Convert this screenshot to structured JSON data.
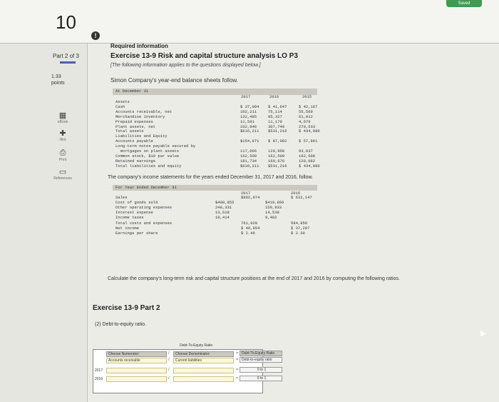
{
  "header": {
    "question_number": "10",
    "save_label": "Saved"
  },
  "sidebar": {
    "part": "Part 2 of 3",
    "points_value": "1.33",
    "points_label": "points",
    "items": [
      {
        "icon": "book-icon",
        "label": "eBook"
      },
      {
        "icon": "hint-icon",
        "label": "Hint"
      },
      {
        "icon": "print-icon",
        "label": "Print"
      },
      {
        "icon": "references-icon",
        "label": "References"
      }
    ]
  },
  "main": {
    "required": "Required information",
    "exercise_title": "Exercise 13-9 Risk and capital structure analysis LO P3",
    "note": "[The following information applies to the questions displayed below.]",
    "intro": "Simon Company's year-end balance sheets follow.",
    "balance_sheet": {
      "header": "At December 31",
      "years": [
        "2017",
        "2016",
        "2015"
      ],
      "rows": [
        {
          "label": "Assets",
          "vals": [
            "",
            "",
            ""
          ]
        },
        {
          "label": "Cash",
          "vals": [
            "$ 37,004",
            "$ 41,647",
            "$ 42,187"
          ]
        },
        {
          "label": "Accounts receivable, net",
          "vals": [
            "102,211",
            "75,114",
            "55,569"
          ]
        },
        {
          "label": "Merchandise inventory",
          "vals": [
            "132,485",
            "95,327",
            "61,012"
          ]
        },
        {
          "label": "Prepaid expenses",
          "vals": [
            "11,591",
            "11,179",
            "4,679"
          ]
        },
        {
          "label": "Plant assets, net",
          "vals": [
            "332,840",
            "307,749",
            "270,633"
          ]
        },
        {
          "label": "Total assets",
          "vals": [
            "$616,211",
            "$531,216",
            "$ 434,080"
          ]
        },
        {
          "label": "Liabilities and Equity",
          "vals": [
            "",
            "",
            ""
          ]
        },
        {
          "label": "Accounts payable",
          "vals": [
            "$154,971",
            "$ 87,082",
            "$ 57,861"
          ]
        },
        {
          "label": "Long-term notes payable secured by",
          "vals": [
            "",
            "",
            ""
          ]
        },
        {
          "label": "  mortgages on plant assets",
          "vals": [
            "117,066",
            "120,958",
            "93,837"
          ]
        },
        {
          "label": "Common stock, $10 par value",
          "vals": [
            "162,500",
            "162,500",
            "162,500"
          ]
        },
        {
          "label": "Retained earnings",
          "vals": [
            "181,734",
            "160,676",
            "120,082"
          ]
        },
        {
          "label": "Total liabilities and equity",
          "vals": [
            "$616,211",
            "$531,216",
            "$ 434,080"
          ]
        }
      ]
    },
    "income_intro": "The company's income statements for the years ended December 31, 2017 and 2016, follow.",
    "income_statement": {
      "header": "For Year Ended December 31",
      "years": [
        "2017",
        "2016"
      ],
      "rows": [
        {
          "label": "Sales",
          "a": "",
          "b": "$802,074",
          "c": "",
          "d": "$ 632,147"
        },
        {
          "label": "Cost of goods sold",
          "a": "$488,855",
          "b": "",
          "c": "$410,896",
          "d": ""
        },
        {
          "label": "Other operating expenses",
          "a": "248,331",
          "b": "",
          "c": "159,933",
          "d": ""
        },
        {
          "label": "Interest expense",
          "a": "13,618",
          "b": "",
          "c": "14,539",
          "d": ""
        },
        {
          "label": "Income taxes",
          "a": "10,414",
          "b": "",
          "c": "9,482",
          "d": ""
        },
        {
          "label": "Total costs and expenses",
          "a": "",
          "b": "761,020",
          "c": "",
          "d": "594,850"
        },
        {
          "label": "Net income",
          "a": "",
          "b": "$ 40,854",
          "c": "",
          "d": "$ 37,297"
        },
        {
          "label": "Earnings per share",
          "a": "",
          "b": "$ 2.46",
          "c": "",
          "d": "$ 2.30"
        }
      ]
    },
    "calc_text": "Calculate the company's long-term risk and capital structure positions at the end of 2017 and 2016 by computing the following ratios.",
    "exercise_part": "Exercise 13-9 Part 2",
    "sub_question": "(2) Debt-to-equity ratio.",
    "ratio_table": {
      "title": "Debt-To-Equity Ratio",
      "col_num": "Choose Numerator:",
      "col_den": "Choose Denominator:",
      "col_res": "Debt-To-Equity Ratio",
      "num_select": "Accounts receivable",
      "den_select": "Current liabilities",
      "res_label": "Debt-to-equity ratio",
      "row_2017": "2017",
      "row_2016": "2016",
      "ratio_2017": "0 to 1",
      "ratio_2016": "0 to 1"
    }
  }
}
